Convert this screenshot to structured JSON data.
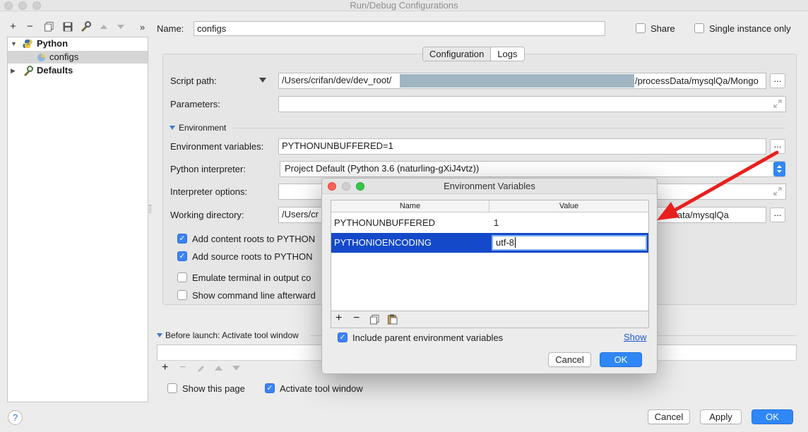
{
  "window": {
    "title": "Run/Debug Configurations"
  },
  "toolbar": {
    "add": "+",
    "remove": "−",
    "expand": "»"
  },
  "tree": [
    {
      "label": "Python",
      "expanded": true
    },
    {
      "label": "configs",
      "selected": true
    },
    {
      "label": "Defaults",
      "expanded": false
    }
  ],
  "name_row": {
    "label": "Name:",
    "value": "configs",
    "share_label": "Share",
    "single_label": "Single instance only"
  },
  "tabs": [
    "Configuration",
    "Logs"
  ],
  "form": {
    "script_label": "Script path:",
    "script_prefix": "/Users/crifan/dev/dev_root/",
    "script_suffix": "/processData/mysqlQa/Mongo",
    "params_label": "Parameters:",
    "env_section": "Environment",
    "envvars_label": "Environment variables:",
    "envvars_value": "PYTHONUNBUFFERED=1",
    "interp_label": "Python interpreter:",
    "interp_value": "Project Default (Python 3.6 (naturling-gXiJ4vtz))",
    "interp_opts_label": "Interpreter options:",
    "workdir_label": "Working directory:",
    "workdir_prefix": "/Users/cr",
    "workdir_suffix": "sData/mysqlQa",
    "content_roots": "Add content roots to PYTHON",
    "source_roots": "Add source roots to PYTHON",
    "emulate": "Emulate terminal in output co",
    "show_cmd": "Show command line afterward",
    "dots": "..."
  },
  "before_launch": {
    "title": "Before launch: Activate tool window",
    "show_page": "Show this page",
    "activate": "Activate tool window"
  },
  "footer": {
    "help": "?",
    "cancel": "Cancel",
    "apply": "Apply",
    "ok": "OK"
  },
  "modal": {
    "title": "Environment Variables",
    "col_name": "Name",
    "col_value": "Value",
    "rows": [
      {
        "name": "PYTHONUNBUFFERED",
        "value": "1"
      },
      {
        "name": "PYTHONIOENCODING",
        "value": "utf-8"
      }
    ],
    "include_parent": "Include parent environment variables",
    "show_link": "Show",
    "cancel": "Cancel",
    "ok": "OK"
  },
  "colors": {
    "accent": "#2f87f6",
    "selection": "#1449c9",
    "arrow": "#e8201e"
  }
}
